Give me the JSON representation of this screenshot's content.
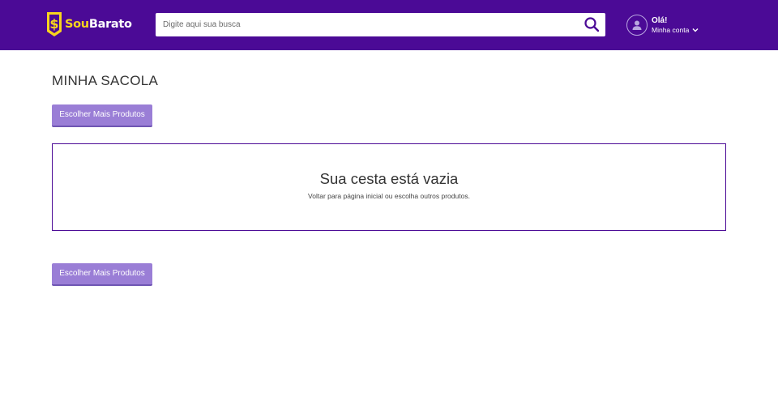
{
  "header": {
    "brand_prefix": "Sou",
    "brand_suffix": "Barato",
    "search": {
      "placeholder": "Digite aqui sua busca",
      "value": ""
    },
    "account": {
      "greeting": "Olá!",
      "link_label": "Minha conta"
    },
    "colors": {
      "background": "#4b0a96",
      "brand_yellow": "#f7d51d"
    },
    "icons": [
      "dollar-badge-icon",
      "search-icon",
      "user-icon",
      "chevron-down-icon"
    ]
  },
  "page": {
    "title": "MINHA SACOLA",
    "button_top_label": "Escolher Mais Produtos",
    "button_bottom_label": "Escolher Mais Produtos",
    "button_color": "#9a7ed6"
  },
  "empty_cart": {
    "title": "Sua cesta está vazia",
    "subtitle": "Voltar para página inicial ou escolha outros produtos."
  }
}
